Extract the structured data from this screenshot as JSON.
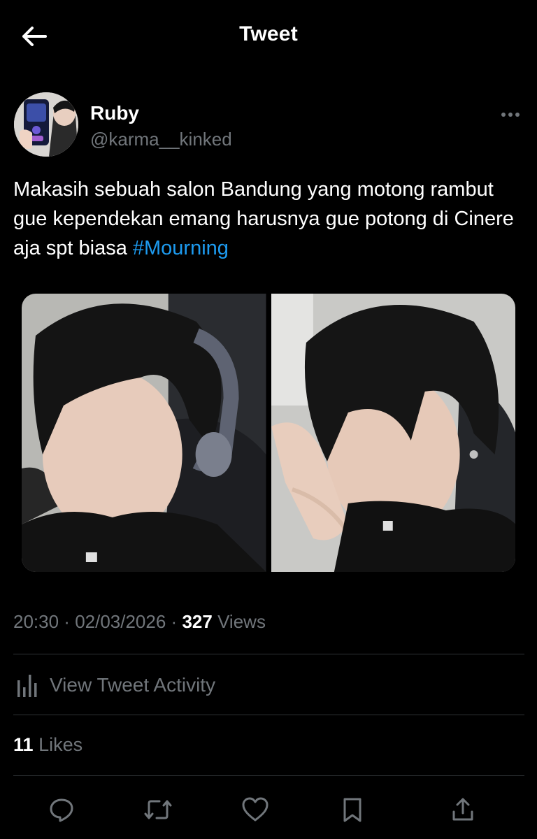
{
  "header": {
    "title": "Tweet",
    "back_icon": "arrow-left-icon"
  },
  "author": {
    "name": "Ruby",
    "handle": "@karma__kinked",
    "more_icon": "more-dots-icon"
  },
  "tweet": {
    "text": "Makasih sebuah salon Bandung yang motong rambut gue kependekan emang harusnya gue potong di Cinere aja spt biasa ",
    "hashtag": "#Mourning",
    "hashtag_color": "#1d9bf0"
  },
  "media": {
    "count": 2
  },
  "meta": {
    "time": "20:30",
    "date": "02/03/2026",
    "separator": " · ",
    "views_count": "327",
    "views_label": "Views"
  },
  "activity": {
    "label": "View Tweet Activity",
    "icon": "bar-chart-icon"
  },
  "likes": {
    "count": "11",
    "label": "Likes"
  },
  "actions": {
    "reply_icon": "reply-icon",
    "retweet_icon": "retweet-icon",
    "like_icon": "heart-icon",
    "bookmark_icon": "bookmark-icon",
    "share_icon": "share-icon"
  },
  "colors": {
    "background": "#000000",
    "primary_text": "#e7e9ea",
    "secondary_text": "#71767b",
    "divider": "#2f3336",
    "accent": "#1d9bf0"
  }
}
